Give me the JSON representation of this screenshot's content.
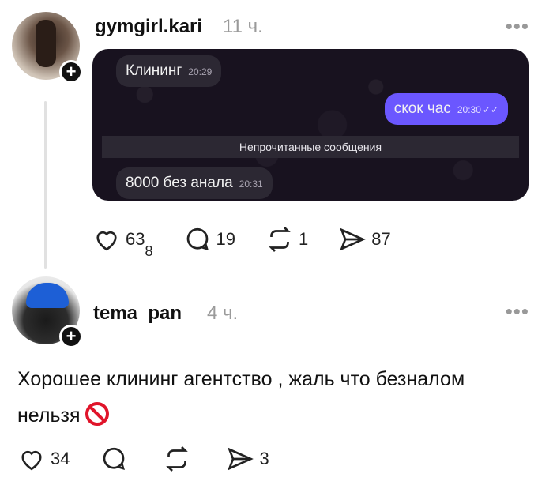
{
  "posts": [
    {
      "username": "gymgirl.kari",
      "time": "11 ч.",
      "chat": {
        "messages": [
          {
            "text": "Клининг",
            "time": "20:29",
            "direction": "in"
          },
          {
            "text": "скок час",
            "time": "20:30",
            "direction": "out"
          },
          {
            "text": "8000 без анала",
            "time": "20:31",
            "direction": "in"
          }
        ],
        "divider": "Непрочитанные сообщения",
        "bg_color": "#18121f",
        "out_bubble_color": "#6b57ff"
      },
      "stats": {
        "likes": "63",
        "likes_sub": "8",
        "comments": "19",
        "reposts": "1",
        "shares": "87"
      }
    },
    {
      "username": "tema_pan_",
      "time": "4 ч.",
      "text": "Хорошее клининг агентство , жаль что безналом нельзя",
      "stats": {
        "likes": "34",
        "comments": "",
        "reposts": "",
        "shares": "3"
      }
    }
  ],
  "icons": {
    "like": "heart-icon",
    "comment": "comment-icon",
    "repost": "repost-icon",
    "share": "share-icon",
    "more": "more-icon",
    "add": "plus-icon",
    "prohibited": "prohibited-emoji-icon"
  }
}
